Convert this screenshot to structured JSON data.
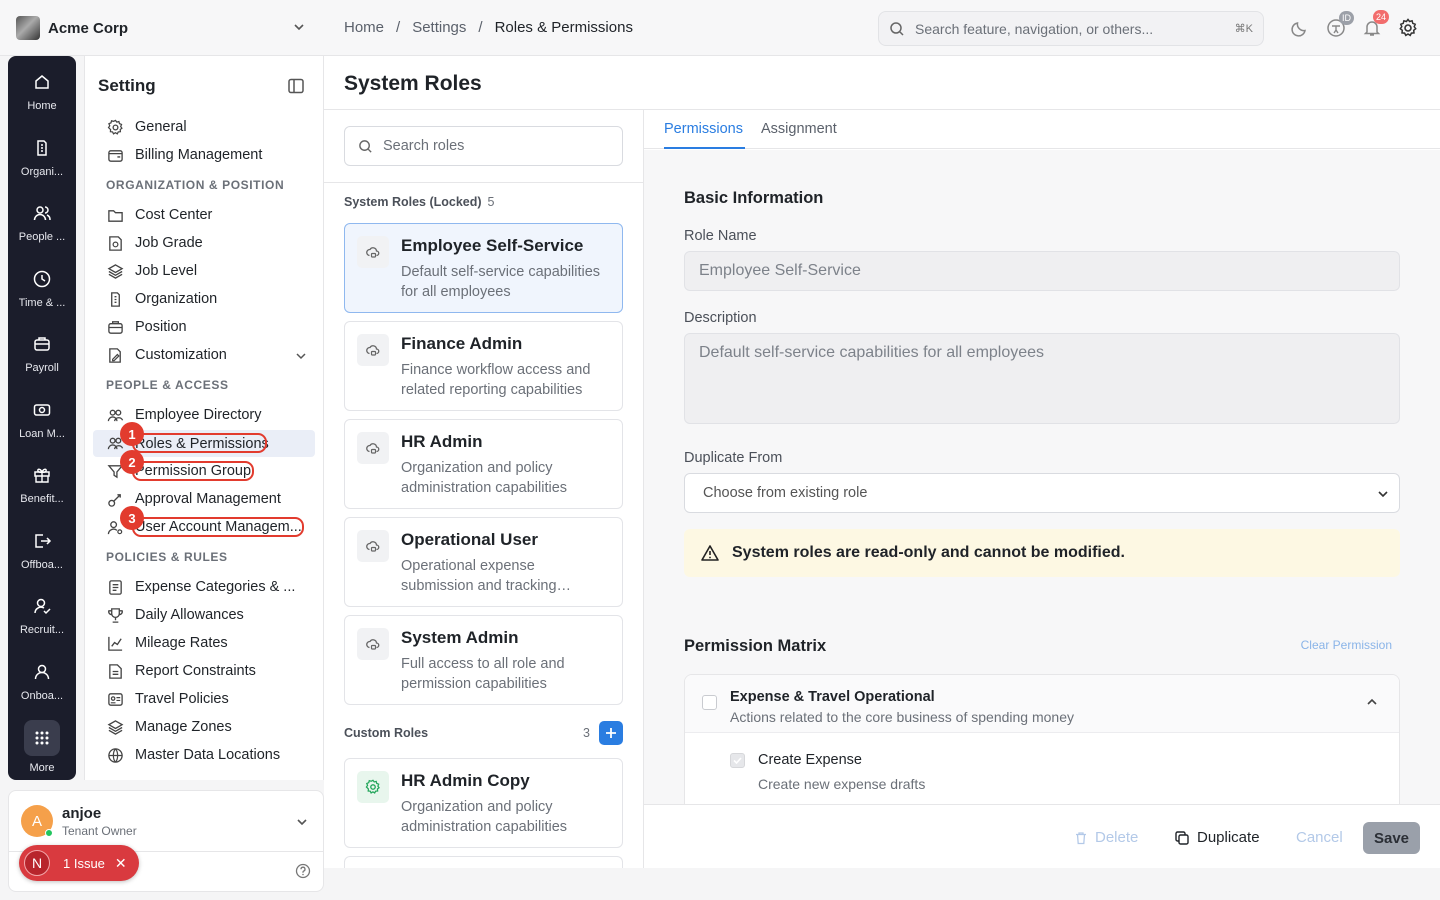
{
  "org": {
    "name": "Acme Corp"
  },
  "breadcrumb": [
    "Home",
    "/",
    "Settings",
    "/",
    "Roles & Permissions"
  ],
  "search": {
    "placeholder": "Search feature, navigation, or others...",
    "shortcut": "⌘K"
  },
  "topbar": {
    "access_badge": "ID",
    "notifications": "24"
  },
  "rail": [
    {
      "label": "Home",
      "icon": "home-icon"
    },
    {
      "label": "Organi...",
      "icon": "building-icon"
    },
    {
      "label": "People ...",
      "icon": "people-icon"
    },
    {
      "label": "Time & ...",
      "icon": "clock-icon"
    },
    {
      "label": "Payroll",
      "icon": "briefcase-icon"
    },
    {
      "label": "Loan M...",
      "icon": "cash-icon"
    },
    {
      "label": "Benefit...",
      "icon": "gift-icon"
    },
    {
      "label": "Offboa...",
      "icon": "exit-icon"
    },
    {
      "label": "Recruit...",
      "icon": "user-check-icon"
    },
    {
      "label": "Onboa...",
      "icon": "user-icon"
    },
    {
      "label": "More",
      "icon": "grid-icon"
    }
  ],
  "sidebar": {
    "title": "Setting",
    "top_items": [
      "General",
      "Billing Management"
    ],
    "section1": "ORGANIZATION & POSITION",
    "org_items": [
      "Cost Center",
      "Job Grade",
      "Job Level",
      "Organization",
      "Position",
      "Customization"
    ],
    "section2": "PEOPLE & ACCESS",
    "people_items": [
      "Employee Directory",
      "Roles & Permissions",
      "Permission Group",
      "Approval Management",
      "User Account Managem..."
    ],
    "section3": "POLICIES & RULES",
    "policy_items": [
      "Expense Categories & ...",
      "Daily Allowances",
      "Mileage Rates",
      "Report Constraints",
      "Travel Policies",
      "Manage Zones",
      "Master Data Locations"
    ],
    "annotations": [
      "1",
      "2",
      "3"
    ]
  },
  "user": {
    "name": "anjoe",
    "role": "Tenant Owner",
    "initial": "A"
  },
  "issue": {
    "initial": "N",
    "label": "1 Issue"
  },
  "main": {
    "title": "System Roles"
  },
  "roles": {
    "search_placeholder": "Search roles",
    "system_label": "System Roles (Locked)",
    "system_count": "5",
    "system": [
      {
        "name": "Employee Self-Service",
        "desc": "Default self-service capabilities for all employees"
      },
      {
        "name": "Finance Admin",
        "desc": "Finance workflow access and related reporting capabilities"
      },
      {
        "name": "HR Admin",
        "desc": "Organization and policy administration capabilities"
      },
      {
        "name": "Operational User",
        "desc": "Operational expense submission and tracking…"
      },
      {
        "name": "System Admin",
        "desc": "Full access to all role and permission capabilities"
      }
    ],
    "custom_label": "Custom Roles",
    "custom_count": "3",
    "custom": [
      {
        "name": "HR Admin Copy",
        "desc": "Organization and policy administration capabilities"
      }
    ]
  },
  "detail": {
    "tabs": [
      "Permissions",
      "Assignment"
    ],
    "basic_info": "Basic Information",
    "role_name_label": "Role Name",
    "role_name_value": "Employee Self-Service",
    "description_label": "Description",
    "description_value": "Default self-service capabilities for all employees",
    "duplicate_label": "Duplicate From",
    "duplicate_placeholder": "Choose from existing role",
    "warning": "System roles are read-only and cannot be modified.",
    "matrix_title": "Permission Matrix",
    "clear_label": "Clear Permission",
    "group": {
      "title": "Expense & Travel Operational",
      "subtitle": "Actions related to the core business of spending money"
    },
    "permission": {
      "title": "Create Expense",
      "subtitle": "Create new expense drafts",
      "checked": true
    }
  },
  "footer": {
    "delete": "Delete",
    "duplicate": "Duplicate",
    "cancel": "Cancel",
    "save": "Save"
  },
  "colors": {
    "accent": "#2a7de1",
    "danger": "#e23b2e",
    "rail": "#1b1d2b",
    "warning_bg": "#fdf8e3"
  }
}
